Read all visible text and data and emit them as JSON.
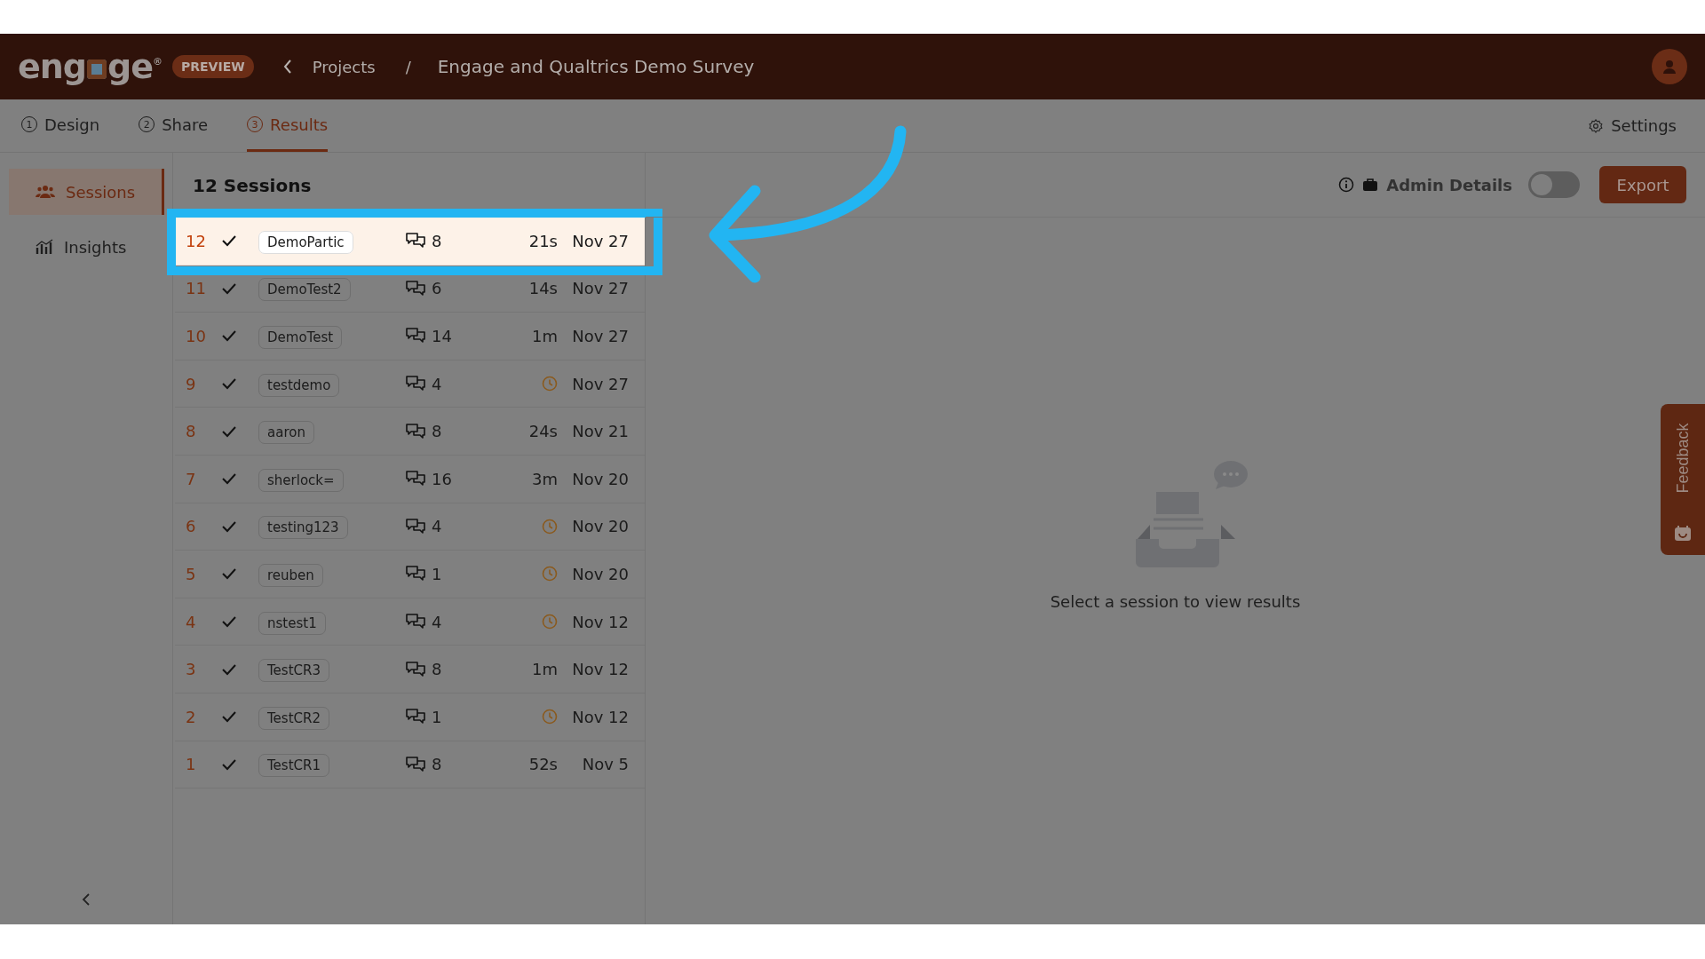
{
  "logo": {
    "before": "eng",
    "after": "ge",
    "mark": "®"
  },
  "badge": "PREVIEW",
  "breadcrumb": {
    "parent": "Projects",
    "separator": "/",
    "current": "Engage and Qualtrics Demo Survey"
  },
  "tabs": [
    {
      "number": "1",
      "label": "Design",
      "selected": false
    },
    {
      "number": "2",
      "label": "Share",
      "selected": false
    },
    {
      "number": "3",
      "label": "Results",
      "selected": true
    }
  ],
  "settings": "Settings",
  "sidebar": {
    "items": [
      {
        "kind": "sessions",
        "label": "Sessions",
        "selected": true
      },
      {
        "kind": "insights",
        "label": "Insights",
        "selected": false
      }
    ]
  },
  "list": {
    "title": "12 Sessions",
    "rows": [
      {
        "number": "12",
        "completed": true,
        "name": "DemoPartic",
        "messages": "8",
        "duration": "21s",
        "date": "Nov 27",
        "selected": true
      },
      {
        "number": "11",
        "completed": true,
        "name": "DemoTest2",
        "messages": "6",
        "duration": "14s",
        "date": "Nov 27",
        "selected": false
      },
      {
        "number": "10",
        "completed": true,
        "name": "DemoTest",
        "messages": "14",
        "duration": "1m",
        "date": "Nov 27",
        "selected": false
      },
      {
        "number": "9",
        "completed": true,
        "name": "testdemo",
        "messages": "4",
        "date": "Nov 27",
        "selected": false
      },
      {
        "number": "8",
        "completed": true,
        "name": "aaron",
        "messages": "8",
        "duration": "24s",
        "date": "Nov 21",
        "selected": false
      },
      {
        "number": "7",
        "completed": true,
        "name": "sherlock=",
        "messages": "16",
        "duration": "3m",
        "date": "Nov 20",
        "selected": false
      },
      {
        "number": "6",
        "completed": true,
        "name": "testing123",
        "messages": "4",
        "date": "Nov 20",
        "selected": false
      },
      {
        "number": "5",
        "completed": true,
        "name": "reuben",
        "messages": "1",
        "date": "Nov 20",
        "selected": false
      },
      {
        "number": "4",
        "completed": true,
        "name": "nstest1",
        "messages": "4",
        "date": "Nov 12",
        "selected": false
      },
      {
        "number": "3",
        "completed": true,
        "name": "TestCR3",
        "messages": "8",
        "duration": "1m",
        "date": "Nov 12",
        "selected": false
      },
      {
        "number": "2",
        "completed": true,
        "name": "TestCR2",
        "messages": "1",
        "date": "Nov 12",
        "selected": false
      },
      {
        "number": "1",
        "completed": true,
        "name": "TestCR1",
        "messages": "8",
        "duration": "52s",
        "date": "Nov 5",
        "selected": false
      }
    ]
  },
  "admin_details": {
    "label": "Admin Details",
    "on": false
  },
  "export": "Export",
  "empty_state": "Select a session to view results",
  "feedback": "Feedback"
}
